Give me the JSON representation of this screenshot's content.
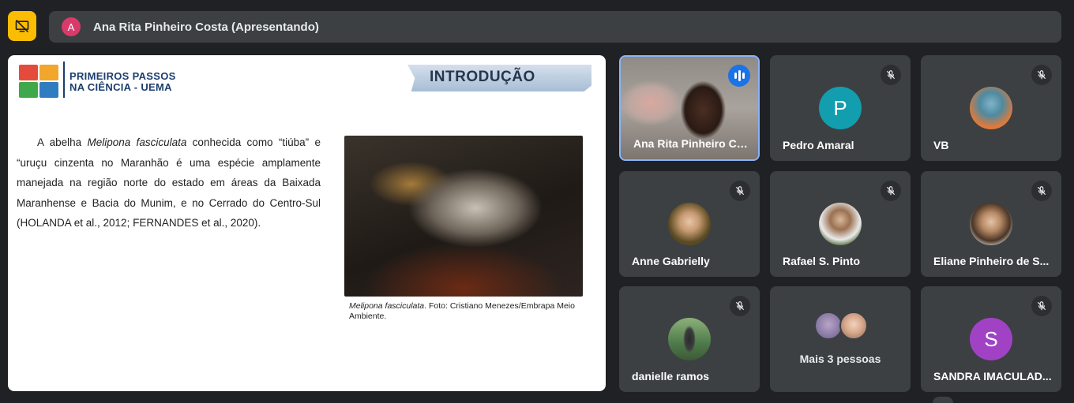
{
  "presenter_bar": {
    "avatar_letter": "A",
    "avatar_color": "#d93a6a",
    "name": "Ana Rita Pinheiro Costa (Apresentando)"
  },
  "present_button": {
    "icon": "stop-presenting-icon",
    "color": "#fbbc04"
  },
  "slide": {
    "logo_line1": "PRIMEIROS PASSOS",
    "logo_line2": "NA CIÊNCIA - UEMA",
    "banner": "INTRODUÇÃO",
    "body_pre": "A abelha ",
    "body_italic": "Melipona fasciculata",
    "body_post": " conhecida como “tiúba” e “uruçu cinzenta no Maranhão é uma espécie amplamente manejada na região norte do estado em áreas da Baixada Maranhense e Bacia do Munim, e no Cerrado do Centro-Sul (HOLANDA et al., 2012; FERNANDES et al., 2020).",
    "caption_italic": "Melipona fasciculata",
    "caption_rest": ". Foto: Cristiano Menezes/Embrapa Meio Ambiente."
  },
  "participants": [
    {
      "name": "Ana Rita Pinheiro Co...",
      "state": "speaking",
      "type": "camera"
    },
    {
      "name": "Pedro Amaral",
      "state": "muted",
      "type": "letter",
      "letter": "P",
      "color": "#129eaf"
    },
    {
      "name": "VB",
      "state": "muted",
      "type": "photo",
      "color": "#e07a3a"
    },
    {
      "name": "Anne Gabrielly",
      "state": "muted",
      "type": "photo",
      "color": "#6b5a2a"
    },
    {
      "name": "Rafael S. Pinto",
      "state": "muted",
      "type": "photo",
      "color": "#4f6a3a"
    },
    {
      "name": "Eliane Pinheiro de S...",
      "state": "muted",
      "type": "photo",
      "color": "#b7a595"
    },
    {
      "name": "danielle ramos",
      "state": "muted",
      "type": "photo",
      "color": "#4e7a4a"
    },
    {
      "more_text": "Mais 3 pessoas",
      "type": "more"
    },
    {
      "name": "SANDRA IMACULAD...",
      "state": "muted",
      "type": "letter",
      "letter": "S",
      "color": "#a142c5"
    }
  ]
}
